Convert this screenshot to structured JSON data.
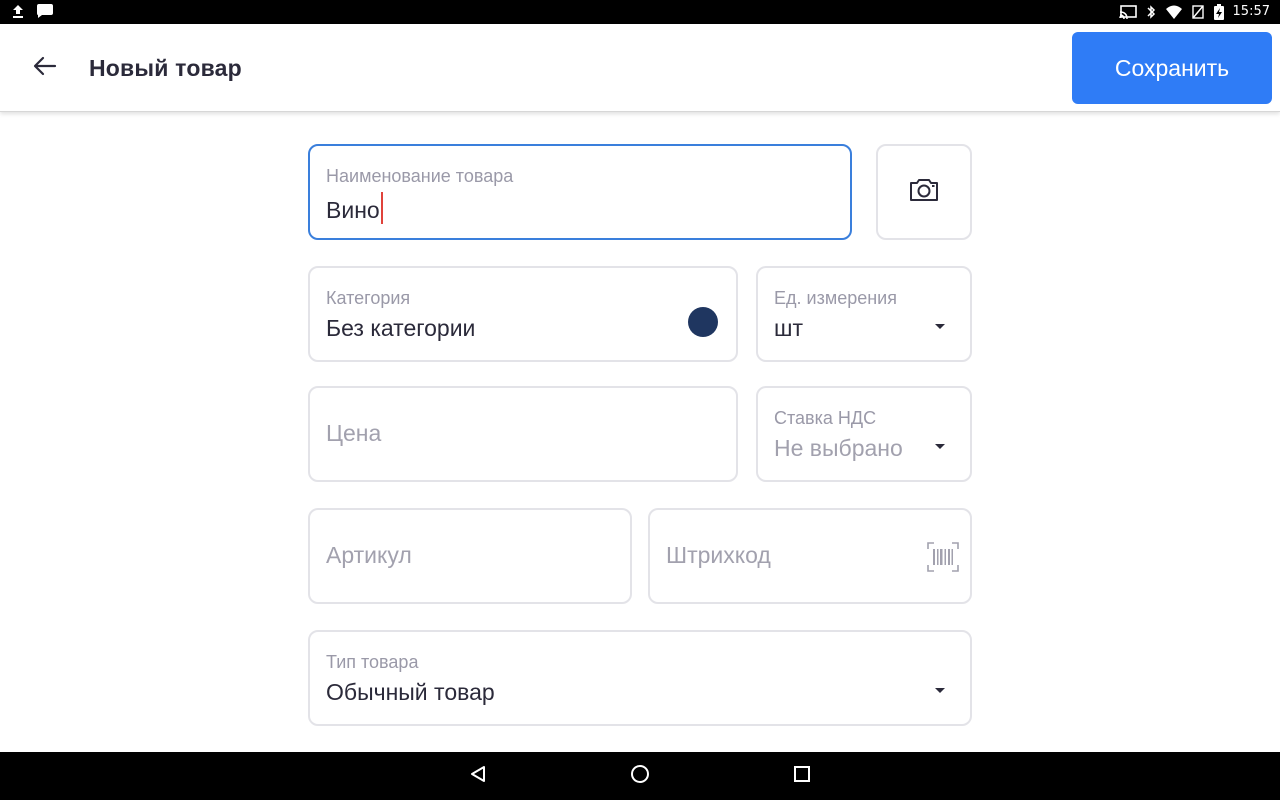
{
  "status_bar": {
    "time": "15:57",
    "left_icons": [
      "upload-icon",
      "chat-icon"
    ],
    "right_icons": [
      "cast-icon",
      "bluetooth-icon",
      "wifi-icon",
      "notification-off-icon",
      "battery-charging-icon"
    ]
  },
  "app_bar": {
    "title": "Новый товар",
    "save_label": "Сохранить",
    "back_icon": "arrow-left-icon"
  },
  "form": {
    "name": {
      "label": "Наименование товара",
      "value": "Вино"
    },
    "photo": {
      "icon": "camera-icon"
    },
    "category": {
      "label": "Категория",
      "value": "Без категории",
      "color": "#1f3660"
    },
    "unit": {
      "label": "Ед. измерения",
      "value": "шт"
    },
    "price": {
      "placeholder": "Цена"
    },
    "vat": {
      "label": "Ставка НДС",
      "value": "Не выбрано"
    },
    "article": {
      "placeholder": "Артикул"
    },
    "barcode": {
      "placeholder": "Штрихкод",
      "icon": "barcode-scan-icon"
    },
    "product_type": {
      "label": "Тип товара",
      "value": "Обычный товар"
    }
  },
  "nav_bar": {
    "icons": [
      "back-triangle-icon",
      "home-circle-icon",
      "recents-square-icon"
    ]
  },
  "colors": {
    "accent": "#2f7cf6",
    "focus_border": "#3a7fdc",
    "caret": "#e0433b",
    "text": "#2b2a3a",
    "muted": "#9a99a8"
  }
}
